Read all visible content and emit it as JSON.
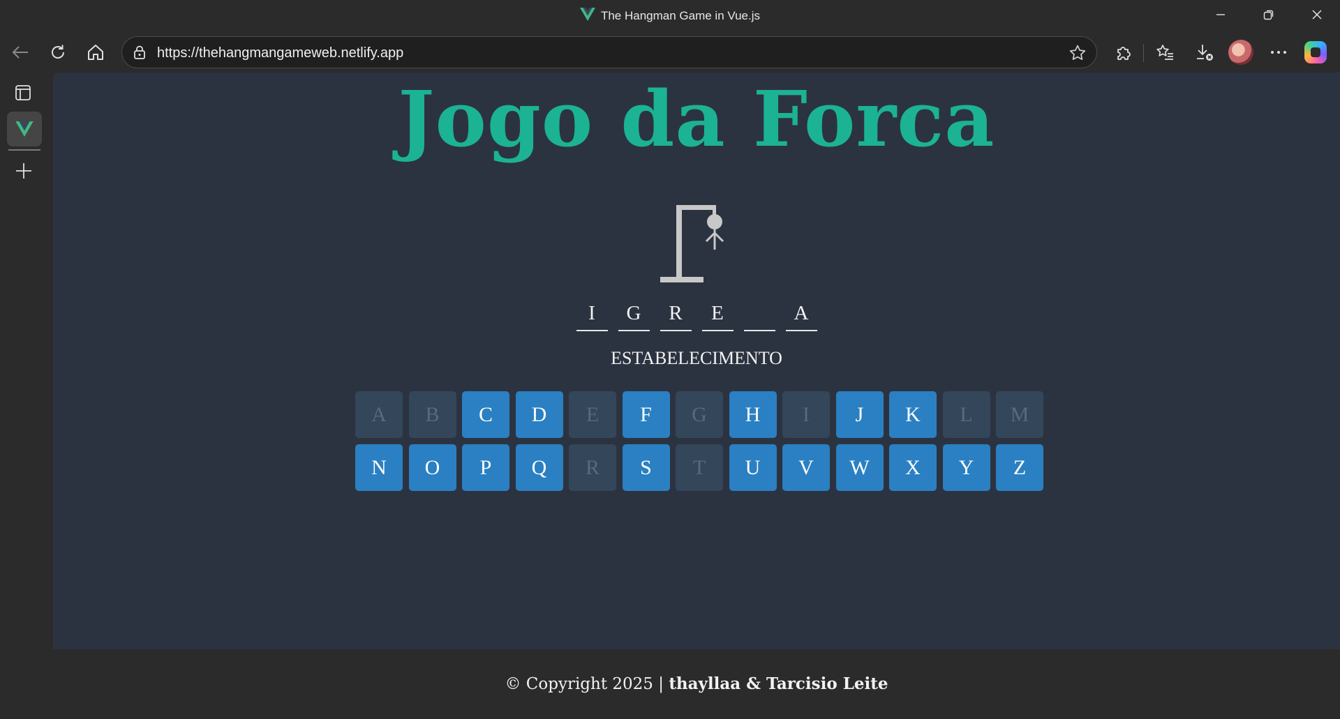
{
  "window": {
    "title": "The Hangman Game in Vue.js"
  },
  "browser": {
    "url": "https://thehangmangameweb.netlify.app"
  },
  "game": {
    "title": "Jogo da Forca",
    "word_slots": [
      "I",
      "G",
      "R",
      "E",
      "",
      "A"
    ],
    "hint": "ESTABELECIMENTO",
    "keys": [
      {
        "letter": "A",
        "enabled": false
      },
      {
        "letter": "B",
        "enabled": false
      },
      {
        "letter": "C",
        "enabled": true
      },
      {
        "letter": "D",
        "enabled": true
      },
      {
        "letter": "E",
        "enabled": false
      },
      {
        "letter": "F",
        "enabled": true
      },
      {
        "letter": "G",
        "enabled": false
      },
      {
        "letter": "H",
        "enabled": true
      },
      {
        "letter": "I",
        "enabled": false
      },
      {
        "letter": "J",
        "enabled": true
      },
      {
        "letter": "K",
        "enabled": true
      },
      {
        "letter": "L",
        "enabled": false
      },
      {
        "letter": "M",
        "enabled": false
      },
      {
        "letter": "N",
        "enabled": true
      },
      {
        "letter": "O",
        "enabled": true
      },
      {
        "letter": "P",
        "enabled": true
      },
      {
        "letter": "Q",
        "enabled": true
      },
      {
        "letter": "R",
        "enabled": false
      },
      {
        "letter": "S",
        "enabled": true
      },
      {
        "letter": "T",
        "enabled": false
      },
      {
        "letter": "U",
        "enabled": true
      },
      {
        "letter": "V",
        "enabled": true
      },
      {
        "letter": "W",
        "enabled": true
      },
      {
        "letter": "X",
        "enabled": true
      },
      {
        "letter": "Y",
        "enabled": true
      },
      {
        "letter": "Z",
        "enabled": true
      }
    ]
  },
  "footer": {
    "prefix": "© Copyright 2025 | ",
    "authors": "thayllaa & Tarcisio Leite"
  },
  "colors": {
    "brand": "#1bb393",
    "key_active": "#2a80c2",
    "key_used": "#33465a",
    "page_bg": "#2c3340"
  }
}
